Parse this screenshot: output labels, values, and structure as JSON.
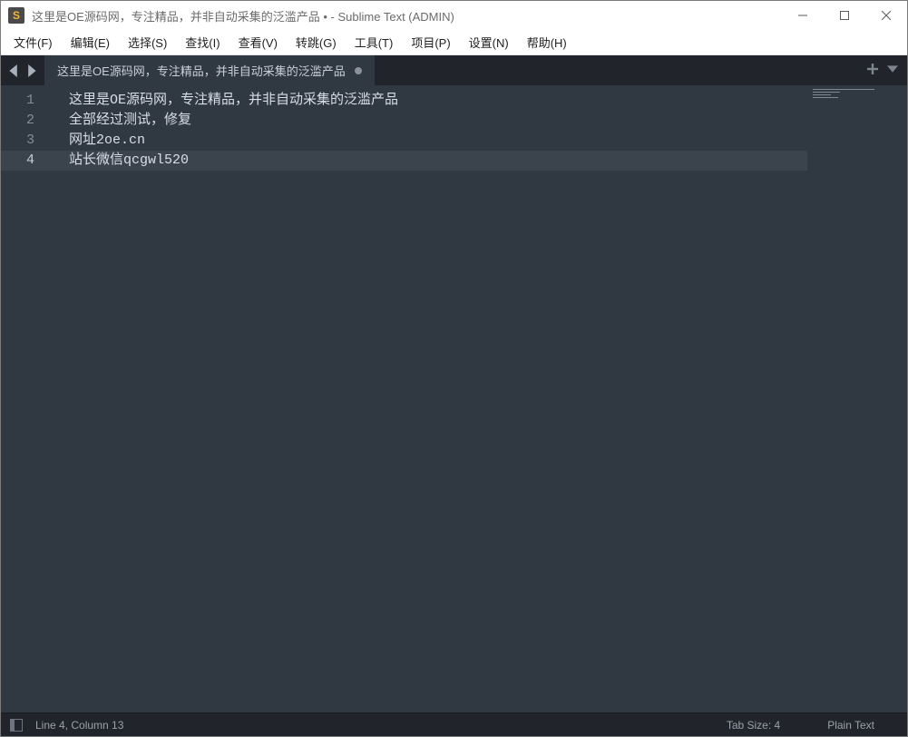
{
  "window": {
    "app_icon_letter": "S",
    "title": "这里是OE源码网，专注精品，并非自动采集的泛滥产品 • - Sublime Text (ADMIN)"
  },
  "menu": {
    "file": "文件(F)",
    "edit": "编辑(E)",
    "select": "选择(S)",
    "find": "查找(I)",
    "view": "查看(V)",
    "goto": "转跳(G)",
    "tools": "工具(T)",
    "project": "项目(P)",
    "settings": "设置(N)",
    "help": "帮助(H)"
  },
  "tab": {
    "label": "这里是OE源码网，专注精品，并非自动采集的泛滥产品"
  },
  "editor": {
    "lines": [
      "这里是OE源码网，专注精品，并非自动采集的泛滥产品",
      "全部经过测试，修复",
      "网址2oe.cn",
      "站长微信qcgwl520"
    ],
    "line_numbers": [
      "1",
      "2",
      "3",
      "4"
    ],
    "current_line_index": 3
  },
  "status": {
    "position": "Line 4, Column 13",
    "tab_size": "Tab Size: 4",
    "syntax": "Plain Text"
  }
}
